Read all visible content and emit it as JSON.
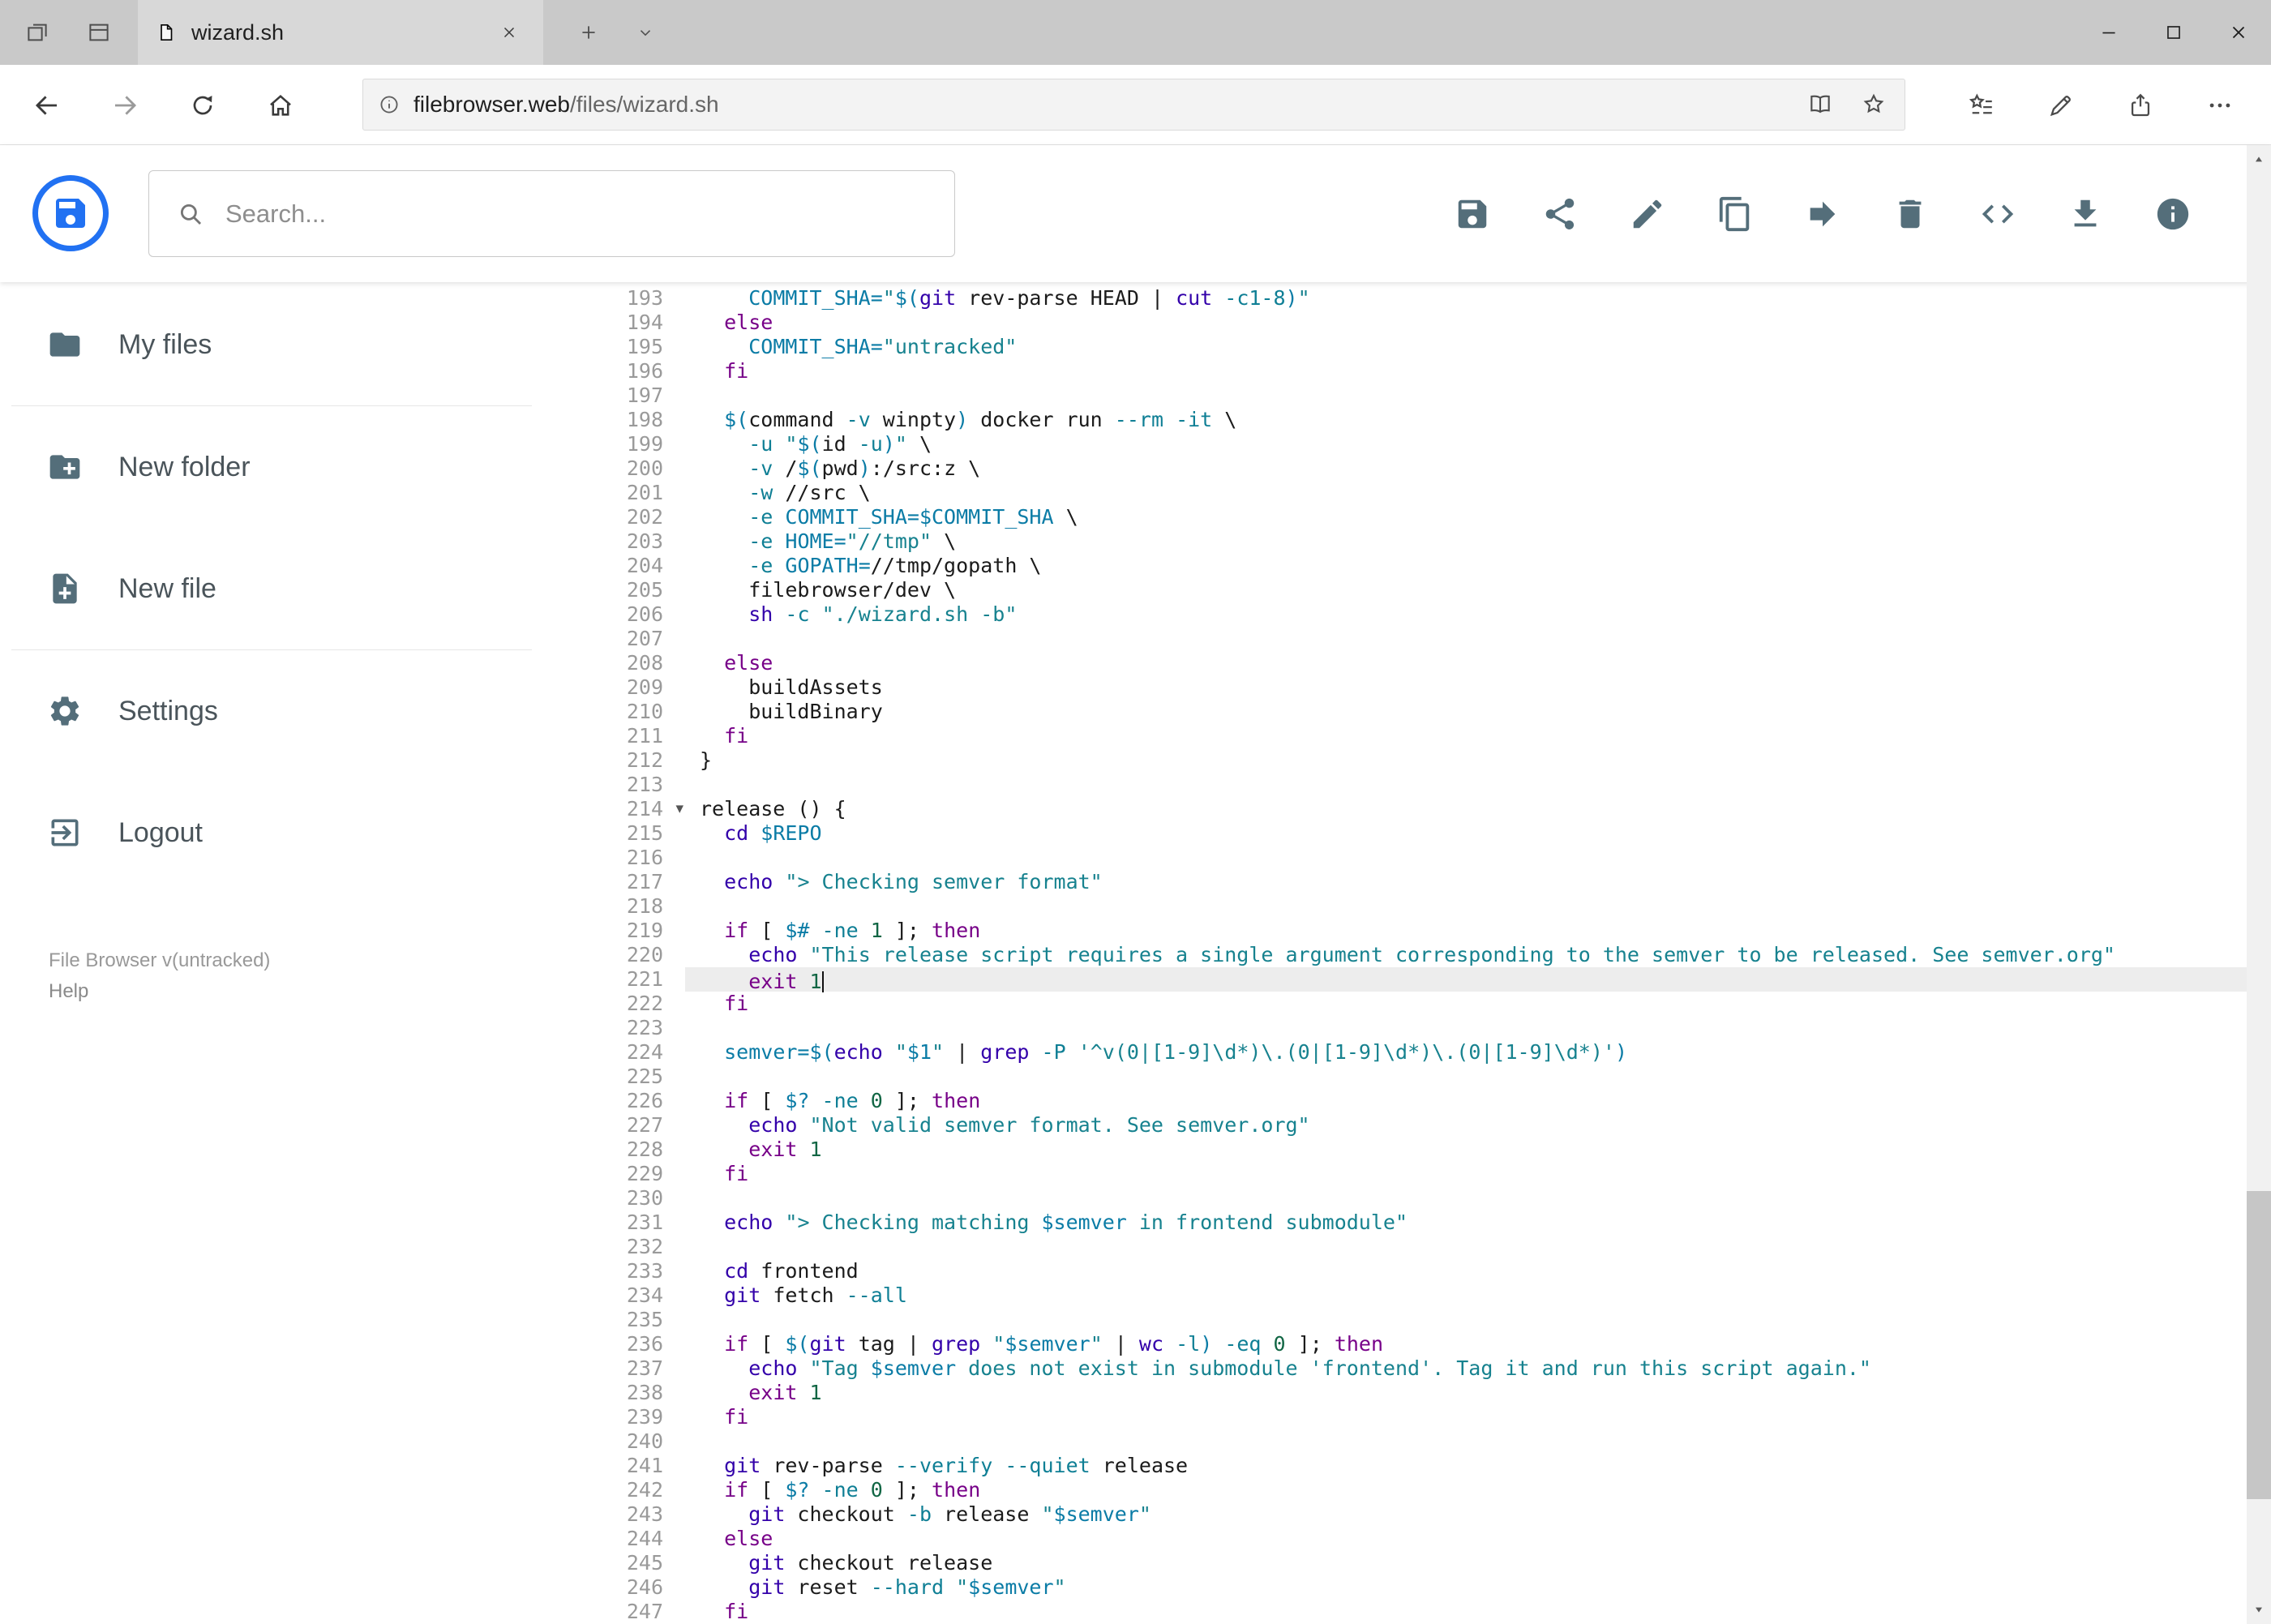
{
  "colors": {
    "accent_blue": "#2171f2",
    "toolbar_icon_gray": "#546e7a",
    "keyword": "#770088",
    "builtin": "#3300aa",
    "string": "#17828f",
    "variable": "#0b7ca6",
    "flag": "#0f7f95",
    "number": "#116644",
    "active_line_bg": "#ededed"
  },
  "browser": {
    "tab_title": "wizard.sh",
    "url_domain": "filebrowser.web",
    "url_path": "/files/wizard.sh"
  },
  "header": {
    "search_placeholder": "Search...",
    "actions": [
      {
        "name": "save",
        "icon": "save"
      },
      {
        "name": "share",
        "icon": "share"
      },
      {
        "name": "edit",
        "icon": "edit"
      },
      {
        "name": "copy",
        "icon": "copy"
      },
      {
        "name": "move",
        "icon": "move"
      },
      {
        "name": "delete",
        "icon": "delete"
      },
      {
        "name": "code",
        "icon": "code"
      },
      {
        "name": "download",
        "icon": "download"
      },
      {
        "name": "info",
        "icon": "info-fill"
      }
    ]
  },
  "sidebar": {
    "items": [
      {
        "label": "My files",
        "icon": "folder"
      },
      {
        "label": "New folder",
        "icon": "folder-plus"
      },
      {
        "label": "New file",
        "icon": "file-plus"
      },
      {
        "label": "Settings",
        "icon": "gear"
      },
      {
        "label": "Logout",
        "icon": "logout"
      }
    ],
    "credits_version": "File Browser v(untracked)",
    "credits_help": "Help"
  },
  "editor": {
    "active_line": 221,
    "cursor_line": 221,
    "fold_line": 214,
    "lines": [
      {
        "n": 193,
        "t": [
          [
            "p",
            "    "
          ],
          [
            "v",
            "COMMIT_SHA="
          ],
          [
            "s",
            "\""
          ],
          [
            "v",
            "$("
          ],
          [
            "b",
            "git"
          ],
          [
            "p",
            " rev-parse HEAD | "
          ],
          [
            "b",
            "cut"
          ],
          [
            "p",
            " "
          ],
          [
            "a",
            "-c1-8"
          ],
          [
            "v",
            ")"
          ],
          [
            "s",
            "\""
          ]
        ]
      },
      {
        "n": 194,
        "t": [
          [
            "p",
            "  "
          ],
          [
            "k",
            "else"
          ]
        ]
      },
      {
        "n": 195,
        "t": [
          [
            "p",
            "    "
          ],
          [
            "v",
            "COMMIT_SHA="
          ],
          [
            "s",
            "\"untracked\""
          ]
        ]
      },
      {
        "n": 196,
        "t": [
          [
            "p",
            "  "
          ],
          [
            "k",
            "fi"
          ]
        ]
      },
      {
        "n": 197,
        "t": []
      },
      {
        "n": 198,
        "t": [
          [
            "p",
            "  "
          ],
          [
            "v",
            "$("
          ],
          [
            "p",
            "command "
          ],
          [
            "a",
            "-v"
          ],
          [
            "p",
            " winpty"
          ],
          [
            "v",
            ")"
          ],
          [
            "p",
            " docker run "
          ],
          [
            "a",
            "--rm"
          ],
          [
            "p",
            " "
          ],
          [
            "a",
            "-it"
          ],
          [
            "p",
            " \\"
          ]
        ]
      },
      {
        "n": 199,
        "t": [
          [
            "p",
            "    "
          ],
          [
            "a",
            "-u"
          ],
          [
            "p",
            " "
          ],
          [
            "s",
            "\""
          ],
          [
            "v",
            "$("
          ],
          [
            "p",
            "id "
          ],
          [
            "a",
            "-u"
          ],
          [
            "v",
            ")"
          ],
          [
            "s",
            "\""
          ],
          [
            "p",
            " \\"
          ]
        ]
      },
      {
        "n": 200,
        "t": [
          [
            "p",
            "    "
          ],
          [
            "a",
            "-v"
          ],
          [
            "p",
            " /"
          ],
          [
            "v",
            "$("
          ],
          [
            "p",
            "pwd"
          ],
          [
            "v",
            ")"
          ],
          [
            "p",
            ":/src:z \\"
          ]
        ]
      },
      {
        "n": 201,
        "t": [
          [
            "p",
            "    "
          ],
          [
            "a",
            "-w"
          ],
          [
            "p",
            " //src \\"
          ]
        ]
      },
      {
        "n": 202,
        "t": [
          [
            "p",
            "    "
          ],
          [
            "a",
            "-e"
          ],
          [
            "p",
            " "
          ],
          [
            "v",
            "COMMIT_SHA=$COMMIT_SHA"
          ],
          [
            "p",
            " \\"
          ]
        ]
      },
      {
        "n": 203,
        "t": [
          [
            "p",
            "    "
          ],
          [
            "a",
            "-e"
          ],
          [
            "p",
            " "
          ],
          [
            "v",
            "HOME="
          ],
          [
            "s",
            "\"//tmp\""
          ],
          [
            "p",
            " \\"
          ]
        ]
      },
      {
        "n": 204,
        "t": [
          [
            "p",
            "    "
          ],
          [
            "a",
            "-e"
          ],
          [
            "p",
            " "
          ],
          [
            "v",
            "GOPATH="
          ],
          [
            "p",
            "//tmp/gopath \\"
          ]
        ]
      },
      {
        "n": 205,
        "t": [
          [
            "p",
            "    filebrowser/dev \\"
          ]
        ]
      },
      {
        "n": 206,
        "t": [
          [
            "p",
            "    "
          ],
          [
            "b",
            "sh"
          ],
          [
            "p",
            " "
          ],
          [
            "a",
            "-c"
          ],
          [
            "p",
            " "
          ],
          [
            "s",
            "\"./wizard.sh -b\""
          ]
        ]
      },
      {
        "n": 207,
        "t": []
      },
      {
        "n": 208,
        "t": [
          [
            "p",
            "  "
          ],
          [
            "k",
            "else"
          ]
        ]
      },
      {
        "n": 209,
        "t": [
          [
            "p",
            "    buildAssets"
          ]
        ]
      },
      {
        "n": 210,
        "t": [
          [
            "p",
            "    buildBinary"
          ]
        ]
      },
      {
        "n": 211,
        "t": [
          [
            "p",
            "  "
          ],
          [
            "k",
            "fi"
          ]
        ]
      },
      {
        "n": 212,
        "t": [
          [
            "p",
            "}"
          ]
        ]
      },
      {
        "n": 213,
        "t": []
      },
      {
        "n": 214,
        "t": [
          [
            "p",
            "release () {"
          ]
        ]
      },
      {
        "n": 215,
        "t": [
          [
            "p",
            "  "
          ],
          [
            "b",
            "cd"
          ],
          [
            "p",
            " "
          ],
          [
            "v",
            "$REPO"
          ]
        ]
      },
      {
        "n": 216,
        "t": []
      },
      {
        "n": 217,
        "t": [
          [
            "p",
            "  "
          ],
          [
            "b",
            "echo"
          ],
          [
            "p",
            " "
          ],
          [
            "s",
            "\"> Checking semver format\""
          ]
        ]
      },
      {
        "n": 218,
        "t": []
      },
      {
        "n": 219,
        "t": [
          [
            "p",
            "  "
          ],
          [
            "k",
            "if"
          ],
          [
            "p",
            " [ "
          ],
          [
            "v",
            "$#"
          ],
          [
            "p",
            " "
          ],
          [
            "a",
            "-ne"
          ],
          [
            "p",
            " "
          ],
          [
            "n",
            "1"
          ],
          [
            "p",
            " ]; "
          ],
          [
            "k",
            "then"
          ]
        ]
      },
      {
        "n": 220,
        "t": [
          [
            "p",
            "    "
          ],
          [
            "b",
            "echo"
          ],
          [
            "p",
            " "
          ],
          [
            "s",
            "\"This release script requires a single argument corresponding to the semver to be released. See semver.org\""
          ]
        ]
      },
      {
        "n": 221,
        "t": [
          [
            "p",
            "    "
          ],
          [
            "k",
            "exit"
          ],
          [
            "p",
            " "
          ],
          [
            "n",
            "1"
          ]
        ]
      },
      {
        "n": 222,
        "t": [
          [
            "p",
            "  "
          ],
          [
            "k",
            "fi"
          ]
        ]
      },
      {
        "n": 223,
        "t": []
      },
      {
        "n": 224,
        "t": [
          [
            "p",
            "  "
          ],
          [
            "v",
            "semver=$("
          ],
          [
            "b",
            "echo"
          ],
          [
            "p",
            " "
          ],
          [
            "s",
            "\""
          ],
          [
            "v",
            "$1"
          ],
          [
            "s",
            "\""
          ],
          [
            "p",
            " | "
          ],
          [
            "b",
            "grep"
          ],
          [
            "p",
            " "
          ],
          [
            "a",
            "-P"
          ],
          [
            "p",
            " "
          ],
          [
            "s",
            "'^v(0|[1-9]\\d*)\\.(0|[1-9]\\d*)\\.(0|[1-9]\\d*)'"
          ],
          [
            "v",
            ")"
          ]
        ]
      },
      {
        "n": 225,
        "t": []
      },
      {
        "n": 226,
        "t": [
          [
            "p",
            "  "
          ],
          [
            "k",
            "if"
          ],
          [
            "p",
            " [ "
          ],
          [
            "v",
            "$?"
          ],
          [
            "p",
            " "
          ],
          [
            "a",
            "-ne"
          ],
          [
            "p",
            " "
          ],
          [
            "n",
            "0"
          ],
          [
            "p",
            " ]; "
          ],
          [
            "k",
            "then"
          ]
        ]
      },
      {
        "n": 227,
        "t": [
          [
            "p",
            "    "
          ],
          [
            "b",
            "echo"
          ],
          [
            "p",
            " "
          ],
          [
            "s",
            "\"Not valid semver format. See semver.org\""
          ]
        ]
      },
      {
        "n": 228,
        "t": [
          [
            "p",
            "    "
          ],
          [
            "k",
            "exit"
          ],
          [
            "p",
            " "
          ],
          [
            "n",
            "1"
          ]
        ]
      },
      {
        "n": 229,
        "t": [
          [
            "p",
            "  "
          ],
          [
            "k",
            "fi"
          ]
        ]
      },
      {
        "n": 230,
        "t": []
      },
      {
        "n": 231,
        "t": [
          [
            "p",
            "  "
          ],
          [
            "b",
            "echo"
          ],
          [
            "p",
            " "
          ],
          [
            "s",
            "\"> Checking matching "
          ],
          [
            "v",
            "$semver"
          ],
          [
            "s",
            " in frontend submodule\""
          ]
        ]
      },
      {
        "n": 232,
        "t": []
      },
      {
        "n": 233,
        "t": [
          [
            "p",
            "  "
          ],
          [
            "b",
            "cd"
          ],
          [
            "p",
            " frontend"
          ]
        ]
      },
      {
        "n": 234,
        "t": [
          [
            "p",
            "  "
          ],
          [
            "b",
            "git"
          ],
          [
            "p",
            " fetch "
          ],
          [
            "a",
            "--all"
          ]
        ]
      },
      {
        "n": 235,
        "t": []
      },
      {
        "n": 236,
        "t": [
          [
            "p",
            "  "
          ],
          [
            "k",
            "if"
          ],
          [
            "p",
            " [ "
          ],
          [
            "v",
            "$("
          ],
          [
            "b",
            "git"
          ],
          [
            "p",
            " tag | "
          ],
          [
            "b",
            "grep"
          ],
          [
            "p",
            " "
          ],
          [
            "s",
            "\""
          ],
          [
            "v",
            "$semver"
          ],
          [
            "s",
            "\""
          ],
          [
            "p",
            " | "
          ],
          [
            "b",
            "wc"
          ],
          [
            "p",
            " "
          ],
          [
            "a",
            "-l"
          ],
          [
            "v",
            ")"
          ],
          [
            "p",
            " "
          ],
          [
            "a",
            "-eq"
          ],
          [
            "p",
            " "
          ],
          [
            "n",
            "0"
          ],
          [
            "p",
            " ]; "
          ],
          [
            "k",
            "then"
          ]
        ]
      },
      {
        "n": 237,
        "t": [
          [
            "p",
            "    "
          ],
          [
            "b",
            "echo"
          ],
          [
            "p",
            " "
          ],
          [
            "s",
            "\"Tag "
          ],
          [
            "v",
            "$semver"
          ],
          [
            "s",
            " does not exist in submodule 'frontend'. Tag it and run this script again.\""
          ]
        ]
      },
      {
        "n": 238,
        "t": [
          [
            "p",
            "    "
          ],
          [
            "k",
            "exit"
          ],
          [
            "p",
            " "
          ],
          [
            "n",
            "1"
          ]
        ]
      },
      {
        "n": 239,
        "t": [
          [
            "p",
            "  "
          ],
          [
            "k",
            "fi"
          ]
        ]
      },
      {
        "n": 240,
        "t": []
      },
      {
        "n": 241,
        "t": [
          [
            "p",
            "  "
          ],
          [
            "b",
            "git"
          ],
          [
            "p",
            " rev-parse "
          ],
          [
            "a",
            "--verify"
          ],
          [
            "p",
            " "
          ],
          [
            "a",
            "--quiet"
          ],
          [
            "p",
            " release"
          ]
        ]
      },
      {
        "n": 242,
        "t": [
          [
            "p",
            "  "
          ],
          [
            "k",
            "if"
          ],
          [
            "p",
            " [ "
          ],
          [
            "v",
            "$?"
          ],
          [
            "p",
            " "
          ],
          [
            "a",
            "-ne"
          ],
          [
            "p",
            " "
          ],
          [
            "n",
            "0"
          ],
          [
            "p",
            " ]; "
          ],
          [
            "k",
            "then"
          ]
        ]
      },
      {
        "n": 243,
        "t": [
          [
            "p",
            "    "
          ],
          [
            "b",
            "git"
          ],
          [
            "p",
            " checkout "
          ],
          [
            "a",
            "-b"
          ],
          [
            "p",
            " release "
          ],
          [
            "s",
            "\""
          ],
          [
            "v",
            "$semver"
          ],
          [
            "s",
            "\""
          ]
        ]
      },
      {
        "n": 244,
        "t": [
          [
            "p",
            "  "
          ],
          [
            "k",
            "else"
          ]
        ]
      },
      {
        "n": 245,
        "t": [
          [
            "p",
            "    "
          ],
          [
            "b",
            "git"
          ],
          [
            "p",
            " checkout release"
          ]
        ]
      },
      {
        "n": 246,
        "t": [
          [
            "p",
            "    "
          ],
          [
            "b",
            "git"
          ],
          [
            "p",
            " reset "
          ],
          [
            "a",
            "--hard"
          ],
          [
            "p",
            " "
          ],
          [
            "s",
            "\""
          ],
          [
            "v",
            "$semver"
          ],
          [
            "s",
            "\""
          ]
        ]
      },
      {
        "n": 247,
        "t": [
          [
            "p",
            "  "
          ],
          [
            "k",
            "fi"
          ]
        ]
      }
    ]
  }
}
